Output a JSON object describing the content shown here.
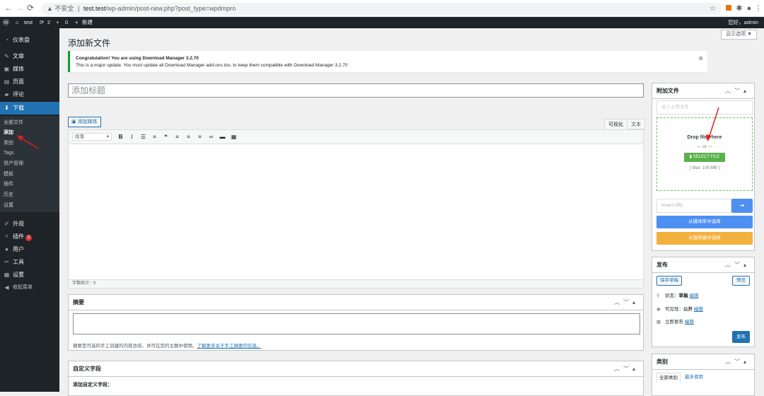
{
  "browser": {
    "back": "←",
    "forward": "→",
    "reload": "⟳",
    "home": "⌂",
    "insecure_label": "不安全",
    "separator": "|",
    "url_host": "test.test",
    "url_path": "/wp-admin/post-new.php?post_type=wpdmpro"
  },
  "admin_bar": {
    "site_name": "test",
    "updates_count": "2",
    "comments_count": "0",
    "new_label": "新建",
    "greeting": "您好，admin"
  },
  "sidebar": {
    "items": [
      {
        "label": "仪表盘",
        "icon": "dashboard-icon"
      },
      {
        "label": "文章",
        "icon": "pin-icon"
      },
      {
        "label": "媒体",
        "icon": "media-icon"
      },
      {
        "label": "页面",
        "icon": "page-icon"
      },
      {
        "label": "评论",
        "icon": "comment-icon"
      },
      {
        "label": "下载",
        "icon": "download-icon"
      }
    ],
    "submenu": [
      "全部文件",
      "添加",
      "类别",
      "Tags",
      "资产管理",
      "模板",
      "插件",
      "历史",
      "设置"
    ],
    "items_bottom": [
      {
        "label": "外观",
        "icon": "brush-icon"
      },
      {
        "label": "插件",
        "icon": "plugin-icon",
        "badge": "2"
      },
      {
        "label": "用户",
        "icon": "user-icon"
      },
      {
        "label": "工具",
        "icon": "wrench-icon"
      },
      {
        "label": "设置",
        "icon": "settings-icon"
      },
      {
        "label": "收起菜单",
        "icon": "collapse-icon"
      }
    ]
  },
  "main": {
    "screen_options": "显示选项 ▼",
    "page_title": "添加新文件",
    "notice": {
      "headline": "Congratulation! You are using Download Manager 3.2.70",
      "body": "This is a major update. You must update all Download Manager add-ons too, to keep them compatible with Download Manager 3.2.70"
    },
    "title_placeholder": "添加标题",
    "add_media": "添加媒体",
    "tab_visual": "可视化",
    "tab_text": "文本",
    "format_select": "段落",
    "word_count": "字数统计：0",
    "excerpt": {
      "title": "摘要",
      "help_text": "摘要是可选的手工创建的内容总结，并可在您的主题中使用。",
      "help_link": "了解更多关于手工摘要的信息。"
    },
    "custom_fields": {
      "title": "自定义字段",
      "add_label": "添加自定义字段："
    }
  },
  "attach": {
    "title": "附加文件",
    "placeholder": "加入上传文件",
    "drop_text": "Drop files here",
    "or_text": "— or —",
    "select_button": "SELECT FILE",
    "max_size": "[ Max: 100 MB ]",
    "insert_url_placeholder": "Insert URL",
    "media_button": "从媒体库中选择",
    "server_button": "从服务器中选择"
  },
  "publish": {
    "title": "发布",
    "save_draft": "保存草稿",
    "preview": "预览",
    "status_label": "状态：",
    "status_value": "草稿",
    "visibility_label": "可见性：",
    "visibility_value": "公开",
    "schedule_label": "立即发布",
    "edit": "编辑",
    "publish_button": "发布"
  },
  "category": {
    "title": "类别",
    "tab_all": "全部类别",
    "tab_popular": "最多使用"
  },
  "colors": {
    "accent": "#2271b1",
    "sidebar_bg": "#1d2327",
    "green": "#5ab14a",
    "blue": "#4e8ff2",
    "orange": "#f2b13f",
    "annotation": "#e0201c"
  }
}
